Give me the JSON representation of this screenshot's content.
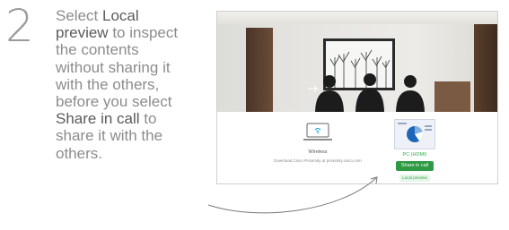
{
  "step": {
    "number": "2"
  },
  "instruction": {
    "t1": "Select ",
    "b1": "Local preview",
    "t2": " to inspect the contents without sharing it with the others, before you select ",
    "b2": "Share in call",
    "t3": " to share it with the others."
  },
  "screen": {
    "wireless": {
      "label": "Wireless",
      "sub": "Download Cisco Proximity at proximity.cisco.com"
    },
    "pc": {
      "label": "PC (HDMI)",
      "share_label": "Share in call",
      "preview_label": "Local preview"
    }
  },
  "colors": {
    "accent_green": "#2e9a43",
    "text_gray": "#8c8c8c",
    "bold_gray": "#5a5a5a"
  }
}
